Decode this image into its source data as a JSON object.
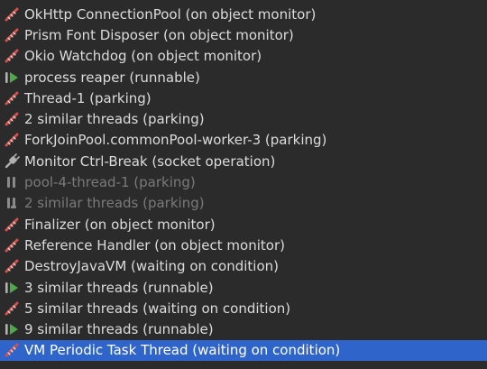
{
  "threads": [
    {
      "label": "OkHttp ConnectionPool (on object monitor)",
      "icon": "thread-monitor-icon",
      "state": "monitor",
      "dim": false,
      "selected": false
    },
    {
      "label": "Prism Font Disposer (on object monitor)",
      "icon": "thread-monitor-icon",
      "state": "monitor",
      "dim": false,
      "selected": false
    },
    {
      "label": "Okio Watchdog (on object monitor)",
      "icon": "thread-monitor-icon",
      "state": "monitor",
      "dim": false,
      "selected": false
    },
    {
      "label": "process reaper (runnable)",
      "icon": "thread-runnable-icon",
      "state": "runnable",
      "dim": false,
      "selected": false
    },
    {
      "label": "Thread-1 (parking)",
      "icon": "thread-parking-icon",
      "state": "parking",
      "dim": false,
      "selected": false
    },
    {
      "label": "2 similar threads (parking)",
      "icon": "thread-parking-icon",
      "state": "parking",
      "dim": false,
      "selected": false
    },
    {
      "label": "ForkJoinPool.commonPool-worker-3 (parking)",
      "icon": "thread-parking-icon",
      "state": "parking",
      "dim": false,
      "selected": false
    },
    {
      "label": "Monitor Ctrl-Break (socket operation)",
      "icon": "socket-plug-icon",
      "state": "socket",
      "dim": false,
      "selected": false
    },
    {
      "label": "pool-4-thread-1 (parking)",
      "icon": "paused-icon",
      "state": "paused",
      "dim": true,
      "selected": false
    },
    {
      "label": "2 similar threads (parking)",
      "icon": "paused-icon",
      "state": "paused-group",
      "dim": true,
      "selected": false
    },
    {
      "label": "Finalizer (on object monitor)",
      "icon": "thread-monitor-icon",
      "state": "monitor",
      "dim": false,
      "selected": false
    },
    {
      "label": "Reference Handler (on object monitor)",
      "icon": "thread-monitor-icon",
      "state": "monitor",
      "dim": false,
      "selected": false
    },
    {
      "label": "DestroyJavaVM (waiting on condition)",
      "icon": "thread-waiting-icon",
      "state": "waiting",
      "dim": false,
      "selected": false
    },
    {
      "label": "3 similar threads (runnable)",
      "icon": "thread-runnable-icon",
      "state": "runnable",
      "dim": false,
      "selected": false
    },
    {
      "label": "5 similar threads (waiting on condition)",
      "icon": "thread-waiting-icon",
      "state": "waiting",
      "dim": false,
      "selected": false
    },
    {
      "label": "9 similar threads (runnable)",
      "icon": "thread-runnable-icon",
      "state": "runnable",
      "dim": false,
      "selected": false
    },
    {
      "label": "VM Periodic Task Thread (waiting on condition)",
      "icon": "thread-waiting-icon",
      "state": "waiting",
      "dim": false,
      "selected": true
    }
  ],
  "colors": {
    "background": "#2b2b2b",
    "text": "#dcdcdc",
    "dim_text": "#7a7a7a",
    "selection": "#2f65ca",
    "thread_red": "#d4504a",
    "runnable_green": "#4fa84a",
    "icon_grey": "#b0b0b0"
  }
}
